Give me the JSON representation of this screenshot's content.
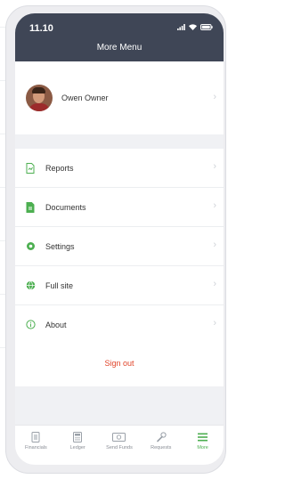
{
  "status": {
    "time": "11.10"
  },
  "header": {
    "title": "More Menu"
  },
  "profile": {
    "name": "Owen Owner"
  },
  "menu": {
    "items": [
      {
        "label": "Reports",
        "icon": "reports-icon"
      },
      {
        "label": "Documents",
        "icon": "documents-icon"
      },
      {
        "label": "Settings",
        "icon": "settings-icon"
      },
      {
        "label": "Full site",
        "icon": "globe-icon"
      },
      {
        "label": "About",
        "icon": "info-icon"
      }
    ]
  },
  "signout": {
    "label": "Sign out"
  },
  "tabbar": {
    "tabs": [
      {
        "label": "Financials",
        "icon": "financials-icon"
      },
      {
        "label": "Ledger",
        "icon": "calculator-icon"
      },
      {
        "label": "Send Funds",
        "icon": "money-icon"
      },
      {
        "label": "Requests",
        "icon": "wrench-icon"
      },
      {
        "label": "More",
        "icon": "menu-icon"
      }
    ],
    "active": "More"
  },
  "colors": {
    "header_bg": "#3f4656",
    "accent_green": "#4caf50",
    "signout_red": "#e1452a",
    "screen_bg": "#f0f1f4"
  }
}
